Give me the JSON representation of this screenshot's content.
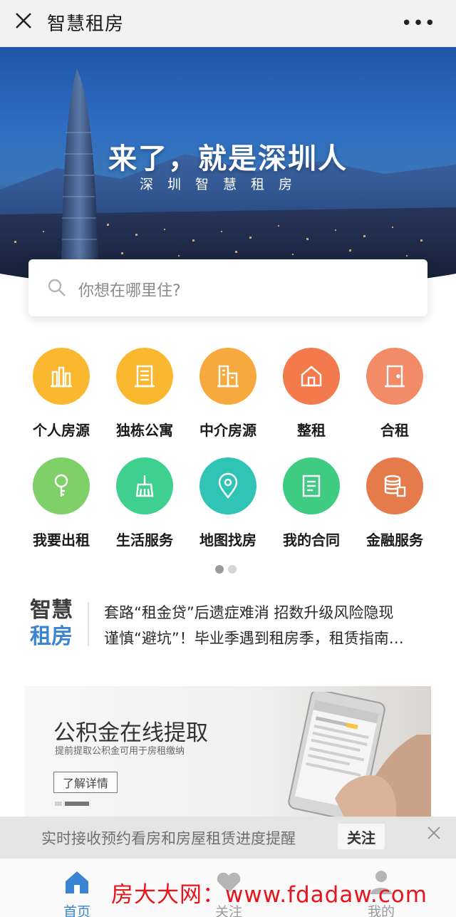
{
  "titlebar": {
    "close_icon": "close-icon",
    "title": "智慧租房",
    "more": "•••"
  },
  "banner": {
    "headline": "来了，就是深圳人",
    "subline": "深圳智慧租房"
  },
  "search": {
    "placeholder": "你想在哪里住?"
  },
  "grid": {
    "items": [
      {
        "label": "个人房源",
        "icon": "building-icon",
        "color": "#f9b830"
      },
      {
        "label": "独栋公寓",
        "icon": "apartment-icon",
        "color": "#f9b830"
      },
      {
        "label": "中介房源",
        "icon": "agency-building-icon",
        "color": "#f6a93c"
      },
      {
        "label": "整租",
        "icon": "house-icon",
        "color": "#f27a4c"
      },
      {
        "label": "合租",
        "icon": "door-icon",
        "color": "#f48b68"
      },
      {
        "label": "我要出租",
        "icon": "key-icon",
        "color": "#7fd069"
      },
      {
        "label": "生活服务",
        "icon": "broom-icon",
        "color": "#3fcf8e"
      },
      {
        "label": "地图找房",
        "icon": "map-pin-icon",
        "color": "#2fc4b6"
      },
      {
        "label": "我的合同",
        "icon": "contract-icon",
        "color": "#3fcc82"
      },
      {
        "label": "金融服务",
        "icon": "coins-icon",
        "color": "#e57a4a"
      }
    ]
  },
  "news": {
    "logo_line1": "智慧",
    "logo_line2": "租房",
    "headlines": [
      "套路“租金贷”后遗症难消 招数升级风险隐现",
      "谨慎“避坑”！毕业季遇到租房季，租赁指南…"
    ]
  },
  "promo": {
    "title": "公积金在线提取",
    "subtitle": "提前提取公积金可用于房租缴纳",
    "button": "了解详情"
  },
  "notice": {
    "text": "实时接收预约看房和房屋租赁进度提醒",
    "button": "关注"
  },
  "tabbar": {
    "tabs": [
      {
        "label": "首页",
        "icon": "home-icon",
        "active": true
      },
      {
        "label": "关注",
        "icon": "heart-icon",
        "active": false
      },
      {
        "label": "我的",
        "icon": "person-icon",
        "active": false
      }
    ]
  },
  "watermark": "房大大网：www.fdadaw.com",
  "colors": {
    "accent": "#3b84d1",
    "watermark": "#e8141c"
  }
}
